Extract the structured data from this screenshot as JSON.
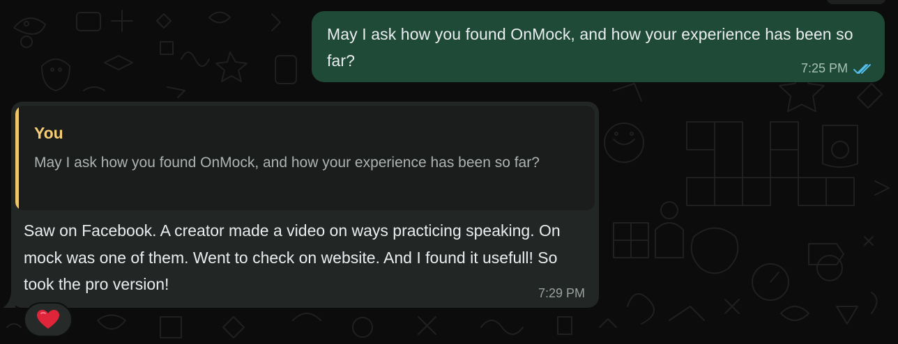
{
  "chat": {
    "outgoing_message": {
      "text": "May I ask how you found OnMock, and how your experience has been so far?",
      "time": "7:25 PM",
      "status_icon": "double-check-read-icon"
    },
    "incoming_message": {
      "quoted": {
        "author": "You",
        "text": "May I ask how you found OnMock, and how your experience has been so far?"
      },
      "text": "Saw on Facebook. A creator made a video on ways practicing speaking. On mock was one of them. Went to check on website. And I found it usefull! So took the pro version!",
      "time": "7:29 PM",
      "reaction": "red-heart-icon"
    }
  },
  "colors": {
    "outgoing_bubble": "#1f4a37",
    "incoming_bubble": "#222625",
    "quote_accent": "#f0c66a",
    "read_ticks": "#53bdeb"
  }
}
